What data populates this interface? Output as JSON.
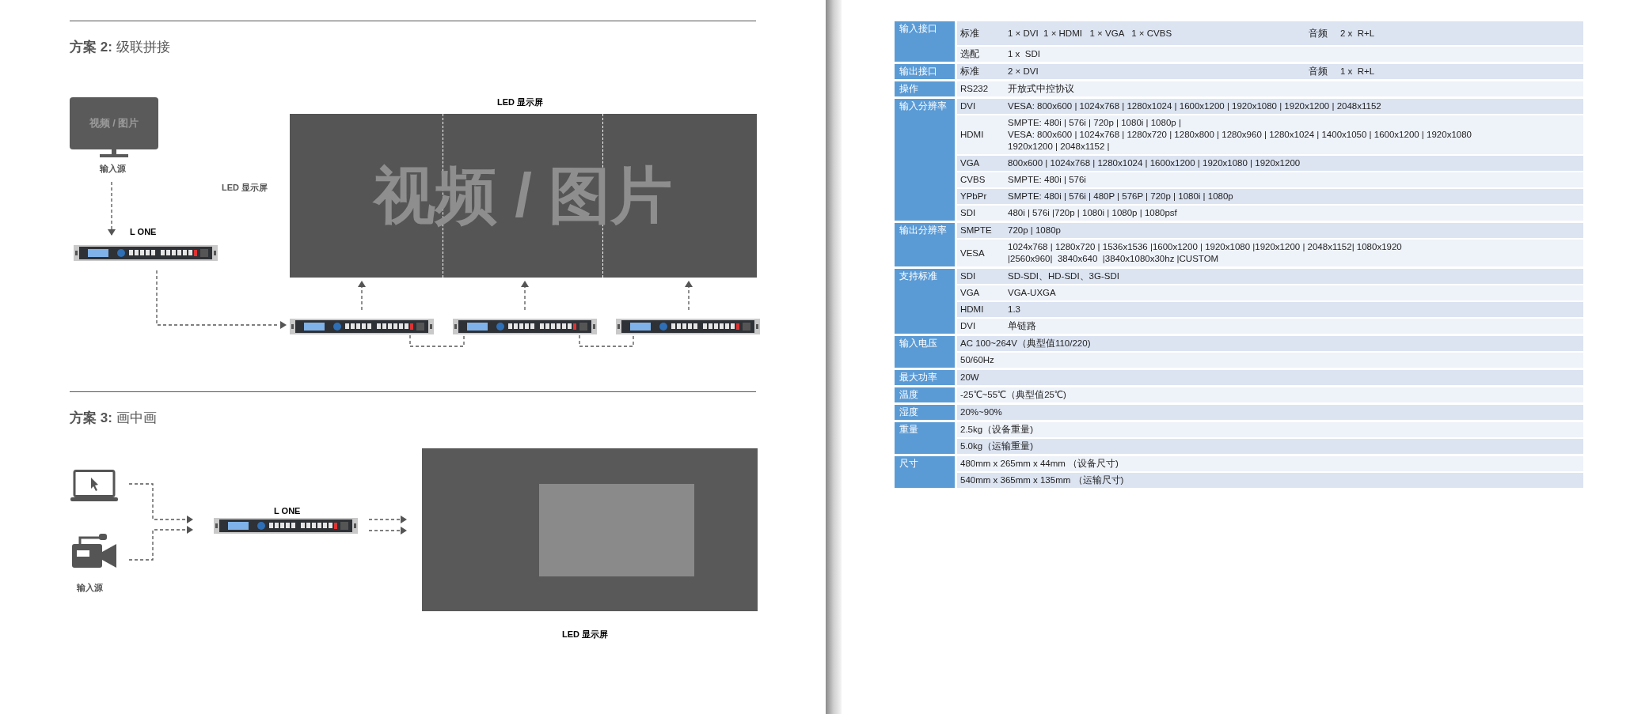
{
  "scheme2": {
    "title": "**方案 2:** 级联拼接",
    "source_screen_text": "视频 / 图片",
    "source_label": "输入源",
    "wall_label": "LED 显示屏",
    "side_label": "LED 显示屏",
    "wall_text": "视频 / 图片",
    "processor_label": "L ONE"
  },
  "scheme3": {
    "title": "**方案 3:** 画中画",
    "source_label": "输入源",
    "processor_label": "L ONE",
    "screen_label": "LED 显示屏"
  },
  "spec_table": {
    "groups": [
      {
        "label": "输入接口",
        "rows": [
          {
            "key": "标准",
            "value": [
              "1 × DVI  1 × HDMI   1 × VGA   1 × CVBS"
            ],
            "audio_label": "音频",
            "audio_value": "2 x  R+L"
          },
          {
            "key": "选配",
            "value": [
              "1 x  SDI"
            ]
          }
        ]
      },
      {
        "label": "输出接口",
        "rows": [
          {
            "key": "标准",
            "value": [
              "2 × DVI"
            ],
            "audio_label": "音频",
            "audio_value": "1 x  R+L"
          }
        ]
      },
      {
        "label": "操作",
        "rows": [
          {
            "key": "RS232",
            "value": [
              "开放式中控协议"
            ]
          }
        ]
      },
      {
        "label": "输入分辨率",
        "rows": [
          {
            "key": "DVI",
            "value": [
              "VESA: 800x600 | 1024x768 | 1280x1024 | 1600x1200 | 1920x1080 | 1920x1200 | 2048x1152"
            ]
          },
          {
            "key": "HDMI",
            "value": [
              "SMPTE: 480i | 576i | 720p | 1080i | 1080p |",
              "VESA: 800x600 | 1024x768 | 1280x720 | 1280x800 | 1280x960 | 1280x1024 | 1400x1050 | 1600x1200 | 1920x1080",
              "1920x1200 | 2048x1152 |"
            ]
          },
          {
            "key": "VGA",
            "value": [
              "800x600 | 1024x768 | 1280x1024 | 1600x1200 | 1920x1080 | 1920x1200"
            ]
          },
          {
            "key": "CVBS",
            "value": [
              "SMPTE: 480i | 576i"
            ]
          },
          {
            "key": "YPbPr",
            "value": [
              "SMPTE: 480i | 576i | 480P | 576P | 720p | 1080i | 1080p"
            ]
          },
          {
            "key": "SDI",
            "value": [
              "480i | 576i |720p | 1080i | 1080p | 1080psf"
            ]
          }
        ]
      },
      {
        "label": "输出分辨率",
        "rows": [
          {
            "key": "SMPTE",
            "value": [
              "720p | 1080p"
            ]
          },
          {
            "key": "VESA",
            "value": [
              "1024x768 | 1280x720 | 1536x1536 |1600x1200 | 1920x1080 |1920x1200 | 2048x1152| 1080x1920",
              "|2560x960|  3840x640  |3840x1080x30hz |CUSTOM"
            ]
          }
        ]
      },
      {
        "label": "支持标准",
        "rows": [
          {
            "key": "SDI",
            "value": [
              "SD-SDI、HD-SDI、3G-SDI"
            ]
          },
          {
            "key": "VGA",
            "value": [
              "VGA-UXGA"
            ]
          },
          {
            "key": "HDMI",
            "value": [
              "1.3"
            ]
          },
          {
            "key": "DVI",
            "value": [
              "单链路"
            ]
          }
        ]
      },
      {
        "label": "输入电压",
        "rows": [
          {
            "value": [
              "AC 100~264V（典型值110/220)"
            ]
          },
          {
            "value": [
              "50/60Hz"
            ]
          }
        ]
      },
      {
        "label": "最大功率",
        "rows": [
          {
            "value": [
              "20W"
            ]
          }
        ]
      },
      {
        "label": "温度",
        "rows": [
          {
            "value": [
              "-25℃~55℃（典型值25℃)"
            ]
          }
        ]
      },
      {
        "label": "湿度",
        "rows": [
          {
            "value": [
              "20%~90%"
            ]
          }
        ]
      },
      {
        "label": "重量",
        "rows": [
          {
            "value": [
              "2.5kg（设备重量)"
            ]
          },
          {
            "value": [
              "5.0kg（运输重量)"
            ]
          }
        ]
      },
      {
        "label": "尺寸",
        "rows": [
          {
            "value": [
              "480mm x 265mm x 44mm （设备尺寸)"
            ]
          },
          {
            "value": [
              "540mm x 365mm x 135mm （运输尺寸)"
            ]
          }
        ]
      }
    ]
  }
}
